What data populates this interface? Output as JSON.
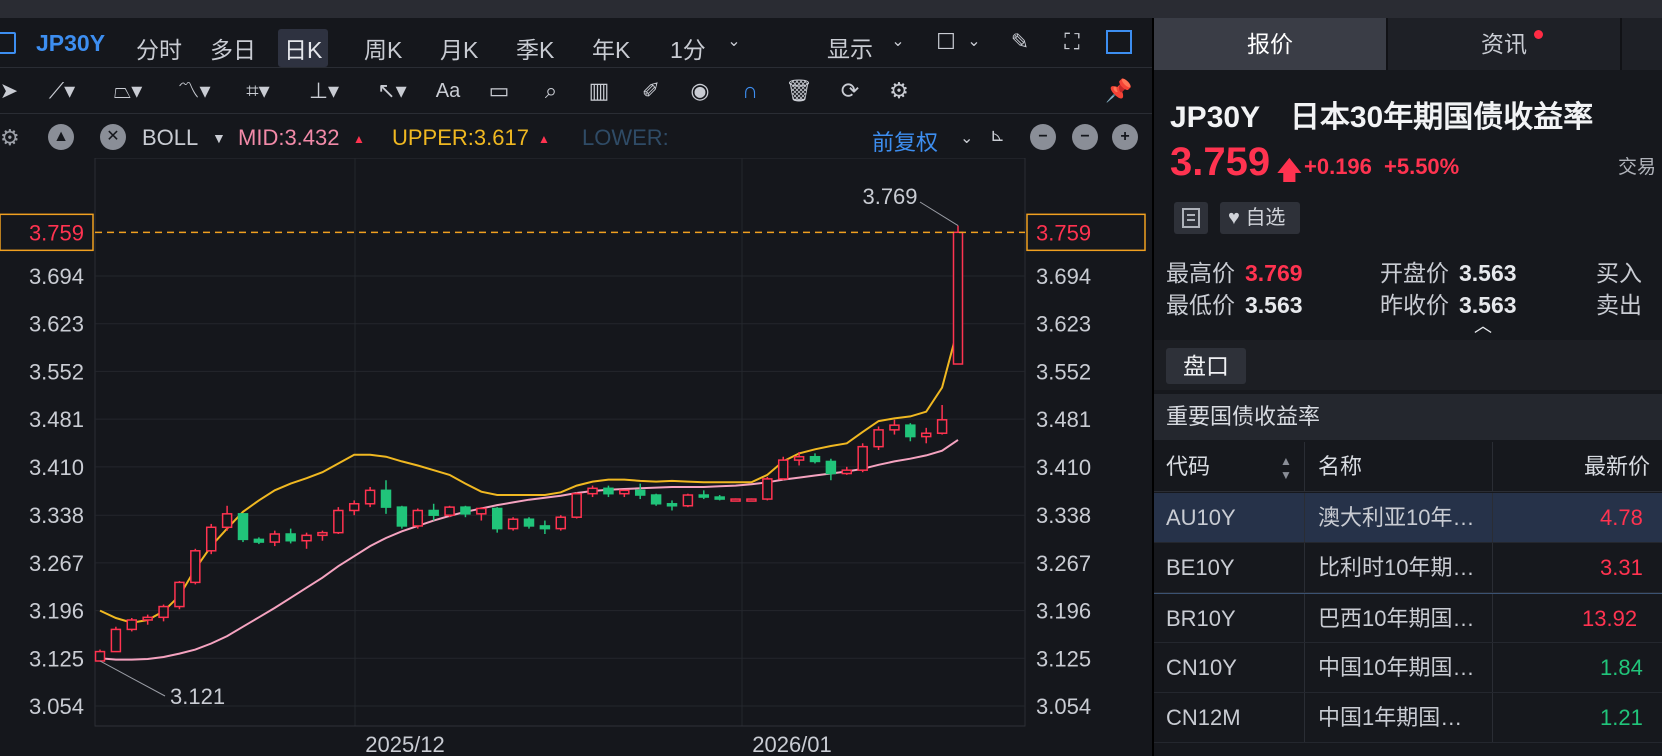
{
  "period_bar": {
    "symbol": "JP30Y",
    "periods": [
      "分时",
      "多日",
      "日K",
      "周K",
      "月K",
      "季K",
      "年K",
      "1分"
    ],
    "active_period": "日K",
    "display_label": "显示"
  },
  "indicator": {
    "name": "BOLL",
    "mid_label": "MID:3.432",
    "upper_label": "UPPER:3.617",
    "lower_label": "LOWER:",
    "adjust_label": "前复权"
  },
  "chart_data": {
    "type": "candlestick",
    "y_ticks": [
      "3.694",
      "3.623",
      "3.552",
      "3.481",
      "3.410",
      "3.338",
      "3.267",
      "3.196",
      "3.125",
      "3.054"
    ],
    "ylim": [
      3.054,
      3.78
    ],
    "x_labels": [
      "2025/12",
      "2026/01"
    ],
    "current_price_tag": "3.759",
    "max_label": "3.769",
    "min_label": "3.121",
    "candles": [
      [
        3.121,
        3.138,
        3.121,
        3.135
      ],
      [
        3.135,
        3.172,
        3.135,
        3.168
      ],
      [
        3.168,
        3.185,
        3.165,
        3.182
      ],
      [
        3.182,
        3.19,
        3.175,
        3.186
      ],
      [
        3.186,
        3.205,
        3.18,
        3.202
      ],
      [
        3.202,
        3.24,
        3.198,
        3.238
      ],
      [
        3.238,
        3.288,
        3.235,
        3.285
      ],
      [
        3.285,
        3.325,
        3.28,
        3.32
      ],
      [
        3.32,
        3.352,
        3.315,
        3.34
      ],
      [
        3.34,
        3.34,
        3.298,
        3.302
      ],
      [
        3.302,
        3.305,
        3.295,
        3.298
      ],
      [
        3.298,
        3.315,
        3.292,
        3.31
      ],
      [
        3.31,
        3.318,
        3.296,
        3.3
      ],
      [
        3.3,
        3.312,
        3.288,
        3.308
      ],
      [
        3.308,
        3.315,
        3.3,
        3.312
      ],
      [
        3.312,
        3.35,
        3.31,
        3.345
      ],
      [
        3.345,
        3.36,
        3.338,
        3.355
      ],
      [
        3.355,
        3.38,
        3.35,
        3.375
      ],
      [
        3.375,
        3.39,
        3.34,
        3.35
      ],
      [
        3.35,
        3.352,
        3.318,
        3.322
      ],
      [
        3.322,
        3.348,
        3.318,
        3.345
      ],
      [
        3.345,
        3.355,
        3.33,
        3.338
      ],
      [
        3.338,
        3.352,
        3.335,
        3.35
      ],
      [
        3.35,
        3.352,
        3.335,
        3.34
      ],
      [
        3.34,
        3.35,
        3.33,
        3.348
      ],
      [
        3.348,
        3.35,
        3.312,
        3.318
      ],
      [
        3.318,
        3.335,
        3.315,
        3.332
      ],
      [
        3.332,
        3.335,
        3.318,
        3.322
      ],
      [
        3.322,
        3.33,
        3.31,
        3.318
      ],
      [
        3.318,
        3.338,
        3.315,
        3.335
      ],
      [
        3.335,
        3.372,
        3.333,
        3.37
      ],
      [
        3.37,
        3.382,
        3.365,
        3.378
      ],
      [
        3.378,
        3.382,
        3.365,
        3.37
      ],
      [
        3.37,
        3.376,
        3.365,
        3.375
      ],
      [
        3.375,
        3.385,
        3.362,
        3.368
      ],
      [
        3.368,
        3.37,
        3.352,
        3.355
      ],
      [
        3.355,
        3.36,
        3.345,
        3.352
      ],
      [
        3.352,
        3.37,
        3.35,
        3.368
      ],
      [
        3.368,
        3.375,
        3.362,
        3.365
      ],
      [
        3.365,
        3.368,
        3.36,
        3.362
      ],
      [
        3.362,
        3.363,
        3.36,
        3.362
      ],
      [
        3.362,
        3.363,
        3.36,
        3.362
      ],
      [
        3.362,
        3.395,
        3.36,
        3.392
      ],
      [
        3.392,
        3.425,
        3.39,
        3.42
      ],
      [
        3.42,
        3.432,
        3.412,
        3.425
      ],
      [
        3.425,
        3.43,
        3.415,
        3.418
      ],
      [
        3.418,
        3.422,
        3.39,
        3.4
      ],
      [
        3.4,
        3.41,
        3.398,
        3.405
      ],
      [
        3.405,
        3.445,
        3.402,
        3.44
      ],
      [
        3.44,
        3.47,
        3.435,
        3.465
      ],
      [
        3.465,
        3.48,
        3.458,
        3.472
      ],
      [
        3.472,
        3.475,
        3.448,
        3.455
      ],
      [
        3.455,
        3.468,
        3.445,
        3.46
      ],
      [
        3.46,
        3.502,
        3.458,
        3.48
      ],
      [
        3.563,
        3.769,
        3.563,
        3.759
      ]
    ],
    "boll_upper": [
      3.196,
      3.185,
      3.178,
      3.182,
      3.195,
      3.218,
      3.258,
      3.292,
      3.318,
      3.343,
      3.36,
      3.375,
      3.385,
      3.393,
      3.402,
      3.415,
      3.428,
      3.428,
      3.425,
      3.418,
      3.412,
      3.405,
      3.398,
      3.385,
      3.373,
      3.368,
      3.368,
      3.368,
      3.368,
      3.372,
      3.382,
      3.388,
      3.391,
      3.391,
      3.389,
      3.388,
      3.389,
      3.388,
      3.387,
      3.387,
      3.387,
      3.387,
      3.398,
      3.418,
      3.43,
      3.436,
      3.441,
      3.445,
      3.462,
      3.478,
      3.482,
      3.485,
      3.492,
      3.528,
      3.617
    ],
    "boll_mid": [
      3.125,
      3.123,
      3.123,
      3.124,
      3.127,
      3.132,
      3.138,
      3.147,
      3.158,
      3.172,
      3.186,
      3.2,
      3.215,
      3.23,
      3.245,
      3.262,
      3.277,
      3.292,
      3.304,
      3.314,
      3.322,
      3.33,
      3.337,
      3.343,
      3.348,
      3.353,
      3.357,
      3.361,
      3.364,
      3.367,
      3.371,
      3.374,
      3.376,
      3.377,
      3.378,
      3.379,
      3.38,
      3.38,
      3.38,
      3.381,
      3.382,
      3.384,
      3.387,
      3.391,
      3.394,
      3.397,
      3.4,
      3.403,
      3.407,
      3.413,
      3.418,
      3.422,
      3.427,
      3.434,
      3.45
    ]
  },
  "quote": {
    "tabs": [
      "报价",
      "资讯"
    ],
    "symbol": "JP30Y",
    "name": "日本30年期国债收益率",
    "price": "3.759",
    "arrow": "🡅",
    "change": "+0.196",
    "change_pct": "+5.50%",
    "exchange_label": "交易",
    "watch_label": "自选",
    "stats": {
      "high_label": "最高价",
      "high": "3.769",
      "open_label": "开盘价",
      "open": "3.563",
      "buy_label": "买入",
      "low_label": "最低价",
      "low": "3.563",
      "prev_label": "昨收价",
      "prev": "3.563",
      "sell_label": "卖出"
    },
    "panko_label": "盘口",
    "section_title": "重要国债收益率",
    "columns": [
      "代码",
      "名称",
      "最新价"
    ],
    "rows": [
      {
        "code": "AU10Y",
        "name": "澳大利亚10年…",
        "value": "4.78",
        "color": "#ff3350"
      },
      {
        "code": "BE10Y",
        "name": "比利时10年期…",
        "value": "3.31",
        "color": "#ff3350"
      },
      {
        "code": "BR10Y",
        "name": "巴西10年期国…",
        "value": "13.92",
        "color": "#ff3350"
      },
      {
        "code": "CN10Y",
        "name": "中国10年期国…",
        "value": "1.84",
        "color": "#21c47a"
      },
      {
        "code": "CN12M",
        "name": "中国1年期国…",
        "value": "1.21",
        "color": "#21c47a"
      }
    ]
  }
}
